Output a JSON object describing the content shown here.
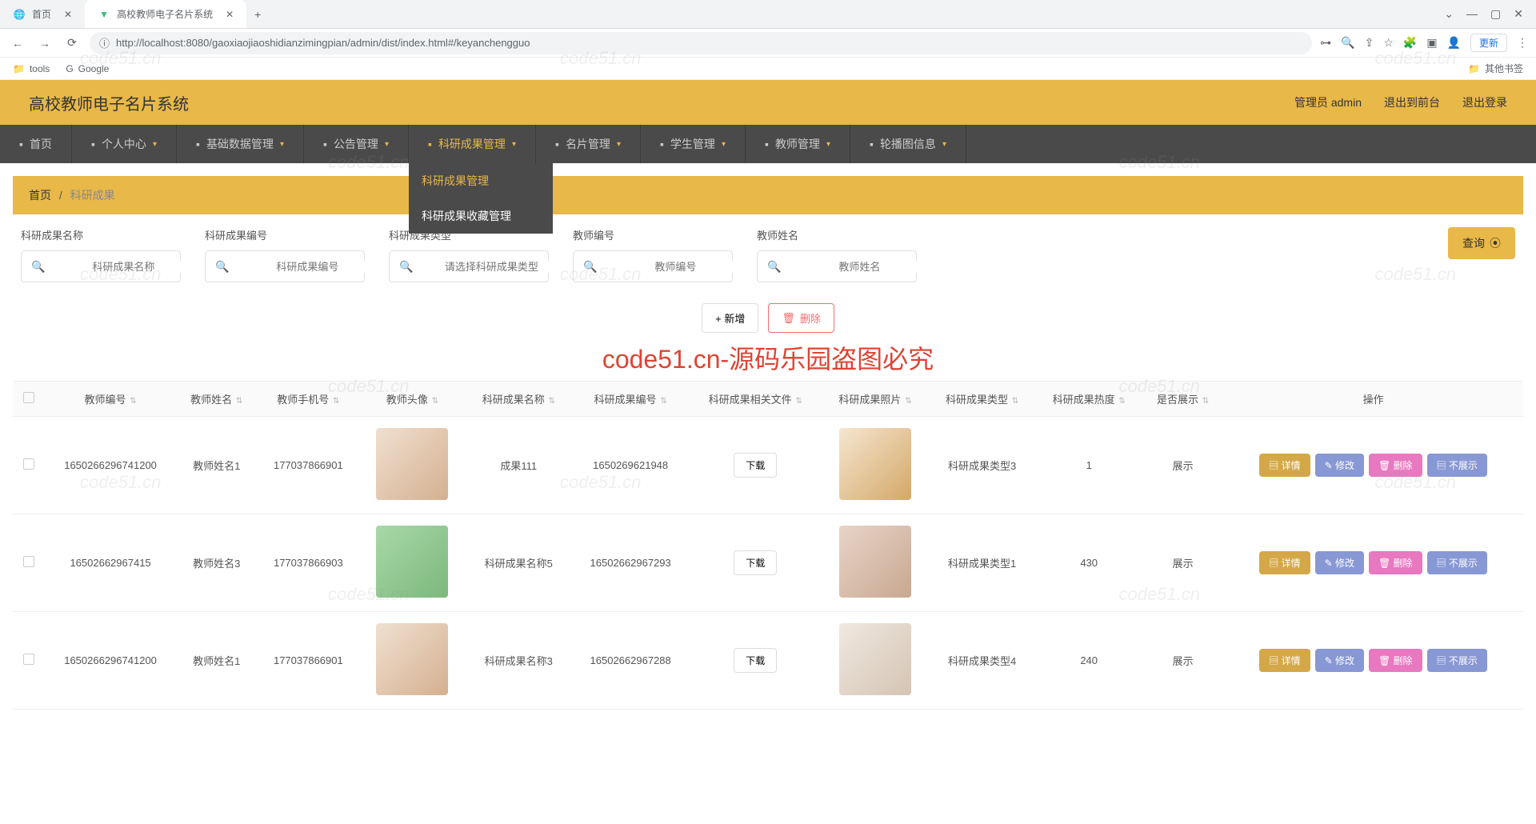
{
  "browser": {
    "tabs": [
      {
        "title": "首页",
        "active": false
      },
      {
        "title": "高校教师电子名片系统",
        "active": true
      }
    ],
    "url": "http://localhost:8080/gaoxiaojiaoshidianzimingpian/admin/dist/index.html#/keyanchengguo",
    "update_label": "更新",
    "bookmarks": {
      "tools": "tools",
      "google": "Google",
      "other": "其他书签"
    }
  },
  "app": {
    "title": "高校教师电子名片系统",
    "user_label": "管理员 admin",
    "logout_front": "退出到前台",
    "logout": "退出登录"
  },
  "nav": {
    "items": [
      {
        "label": "首页",
        "icon": "home",
        "arrow": false
      },
      {
        "label": "个人中心",
        "icon": "user",
        "arrow": true
      },
      {
        "label": "基础数据管理",
        "icon": "gear",
        "arrow": true
      },
      {
        "label": "公告管理",
        "icon": "bullhorn",
        "arrow": true
      },
      {
        "label": "科研成果管理",
        "icon": "user",
        "arrow": true,
        "selected": true
      },
      {
        "label": "名片管理",
        "icon": "card",
        "arrow": true
      },
      {
        "label": "学生管理",
        "icon": "briefcase",
        "arrow": true
      },
      {
        "label": "教师管理",
        "icon": "monitor",
        "arrow": true
      },
      {
        "label": "轮播图信息",
        "icon": "image",
        "arrow": true
      }
    ],
    "dropdown": [
      {
        "label": "科研成果管理",
        "highlight": true
      },
      {
        "label": "科研成果收藏管理",
        "highlight": false
      }
    ]
  },
  "breadcrumb": {
    "home": "首页",
    "current": "科研成果"
  },
  "filters": {
    "name": {
      "label": "科研成果名称",
      "placeholder": "科研成果名称"
    },
    "code": {
      "label": "科研成果编号",
      "placeholder": "科研成果编号"
    },
    "type": {
      "label": "科研成果类型",
      "placeholder": "请选择科研成果类型"
    },
    "teacher_code": {
      "label": "教师编号",
      "placeholder": "教师编号"
    },
    "teacher_name": {
      "label": "教师姓名",
      "placeholder": "教师姓名"
    },
    "query_btn": "查询"
  },
  "actions": {
    "add": "+ 新增",
    "delete": "删除"
  },
  "watermark_big": "code51.cn-源码乐园盗图必究",
  "watermark_small": "code51.cn",
  "table": {
    "headers": {
      "teacher_code": "教师编号",
      "teacher_name": "教师姓名",
      "teacher_phone": "教师手机号",
      "teacher_avatar": "教师头像",
      "res_name": "科研成果名称",
      "res_code": "科研成果编号",
      "res_file": "科研成果相关文件",
      "res_photo": "科研成果照片",
      "res_type": "科研成果类型",
      "res_heat": "科研成果热度",
      "is_show": "是否展示",
      "ops": "操作"
    },
    "download": "下载",
    "op_detail": "详情",
    "op_edit": "修改",
    "op_delete": "删除",
    "op_hide": "不展示",
    "rows": [
      {
        "teacher_code": "1650266296741200",
        "teacher_name": "教师姓名1",
        "teacher_phone": "177037866901",
        "res_name": "成果111",
        "res_code": "1650269621948",
        "res_type": "科研成果类型3",
        "res_heat": "1",
        "is_show": "展示",
        "avatar_cls": "avatar-1",
        "photo_cls": "photo-1"
      },
      {
        "teacher_code": "16502662967415",
        "teacher_name": "教师姓名3",
        "teacher_phone": "177037866903",
        "res_name": "科研成果名称5",
        "res_code": "16502662967293",
        "res_type": "科研成果类型1",
        "res_heat": "430",
        "is_show": "展示",
        "avatar_cls": "avatar-2",
        "photo_cls": "photo-2"
      },
      {
        "teacher_code": "1650266296741200",
        "teacher_name": "教师姓名1",
        "teacher_phone": "177037866901",
        "res_name": "科研成果名称3",
        "res_code": "16502662967288",
        "res_type": "科研成果类型4",
        "res_heat": "240",
        "is_show": "展示",
        "avatar_cls": "avatar-1",
        "photo_cls": "photo-3"
      }
    ]
  }
}
